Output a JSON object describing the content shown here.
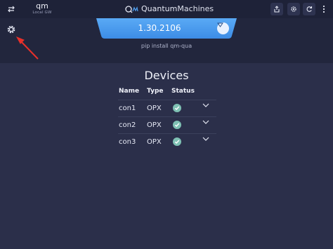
{
  "topbar": {
    "project_name": "qm",
    "project_sub": "Local GW",
    "brand_first": "Quantum",
    "brand_second": "Machines"
  },
  "header": {
    "version": "1.30.2106",
    "install_hint": "pip install qm-qua"
  },
  "devices": {
    "title": "Devices",
    "columns": [
      "Name",
      "Type",
      "Status"
    ],
    "rows": [
      {
        "name": "con1",
        "type": "OPX",
        "status": "ok"
      },
      {
        "name": "con2",
        "type": "OPX",
        "status": "ok"
      },
      {
        "name": "con3",
        "type": "OPX",
        "status": "ok"
      }
    ]
  },
  "colors": {
    "background": "#2b2f4a",
    "topbar": "#1e2238",
    "version_tab": "#4f9ff0",
    "status_ok": "#7fc1b4",
    "annotation_arrow": "#e8302a"
  },
  "icons": {
    "topbar_left": "swap-arrows-icon",
    "topbar_right": [
      "share-icon",
      "gear-icon",
      "refresh-icon",
      "more-vertical-icon"
    ],
    "settings": "gear-icon",
    "dropdown": "triangle-down-icon",
    "status": "checkmark-icon",
    "expand": "chevron-down-icon"
  }
}
